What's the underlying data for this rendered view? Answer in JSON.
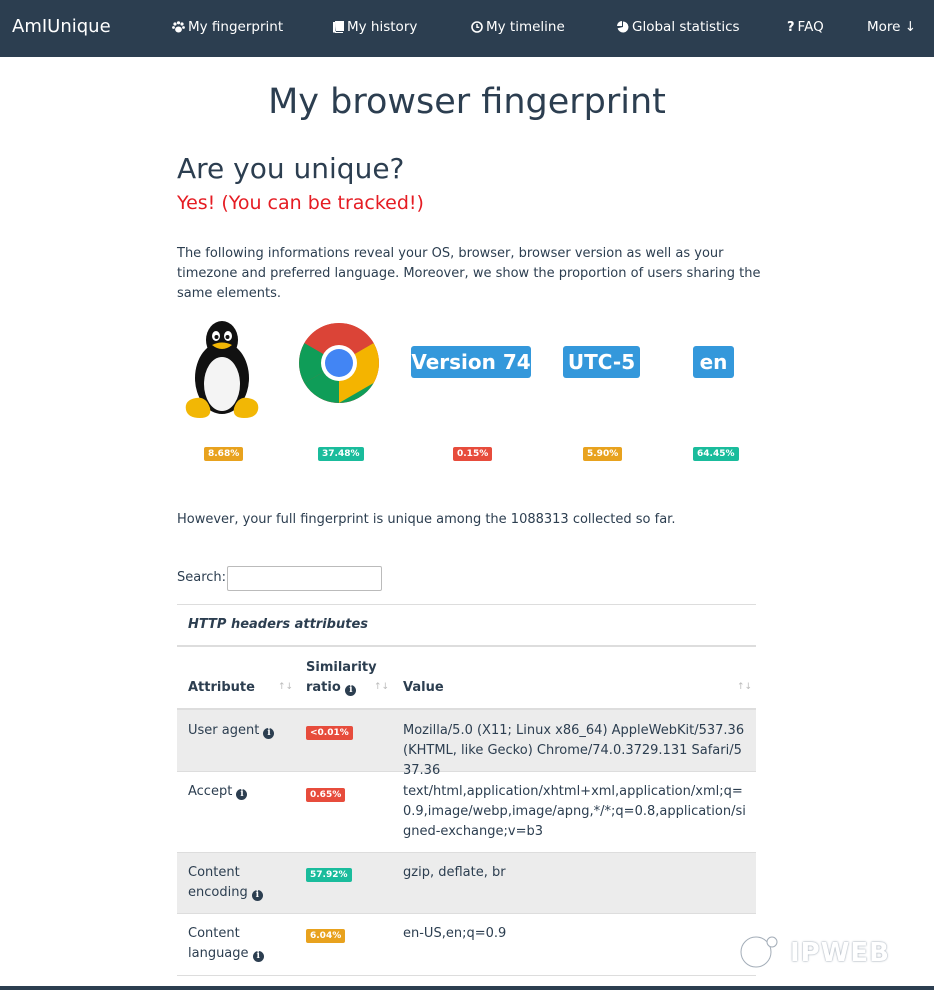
{
  "navbar": {
    "brand": "AmIUnique",
    "items": [
      {
        "label": "My fingerprint",
        "icon": "paw-icon"
      },
      {
        "label": "My history",
        "icon": "book-icon"
      },
      {
        "label": "My timeline",
        "icon": "clock-icon"
      },
      {
        "label": "Global statistics",
        "icon": "pie-chart-icon"
      },
      {
        "label": "FAQ",
        "icon": "question-icon"
      },
      {
        "label": "More ↓",
        "icon": ""
      }
    ]
  },
  "main": {
    "title": "My browser fingerprint",
    "question": "Are you unique?",
    "answer": "Yes! (You can be tracked!)",
    "intro": "The following informations reveal your OS, browser, browser version as well as your timezone and preferred language. Moreover, we show the proportion of users sharing the same elements.",
    "summary": [
      {
        "kind": "image",
        "icon": "linux-tux-icon",
        "percent": "8.68%",
        "color": "#e8a21e"
      },
      {
        "kind": "image",
        "icon": "chrome-icon",
        "percent": "37.48%",
        "color": "#1abc9c"
      },
      {
        "kind": "label",
        "label": "Version 74",
        "percent": "0.15%",
        "color": "#e74c3c"
      },
      {
        "kind": "label",
        "label": "UTC-5",
        "percent": "5.90%",
        "color": "#e8a21e"
      },
      {
        "kind": "label",
        "label": "en",
        "percent": "64.45%",
        "color": "#1abc9c"
      }
    ],
    "unique_line": "However, your full fingerprint is unique among the 1088313 collected so far.",
    "search_label": "Search:",
    "search_value": "",
    "section_title": "HTTP headers attributes",
    "table": {
      "headers": [
        "Attribute",
        "Similarity ratio",
        "Value"
      ],
      "rows": [
        {
          "attribute": "User agent",
          "ratio": "<0.01%",
          "ratio_color": "#e74c3c",
          "value": "Mozilla/5.0 (X11; Linux x86_64) AppleWebKit/537.36 (KHTML, like Gecko) Chrome/74.0.3729.131 Safari/537.36"
        },
        {
          "attribute": "Accept",
          "ratio": "0.65%",
          "ratio_color": "#e74c3c",
          "value": "text/html,application/xhtml+xml,application/xml;q=0.9,image/webp,image/apng,*/*;q=0.8,application/signed-exchange;v=b3"
        },
        {
          "attribute": "Content encoding",
          "ratio": "57.92%",
          "ratio_color": "#1abc9c",
          "value": "gzip, deflate, br"
        },
        {
          "attribute": "Content language",
          "ratio": "6.04%",
          "ratio_color": "#e8a21e",
          "value": "en-US,en;q=0.9"
        }
      ]
    }
  },
  "watermark": "IPWEB"
}
